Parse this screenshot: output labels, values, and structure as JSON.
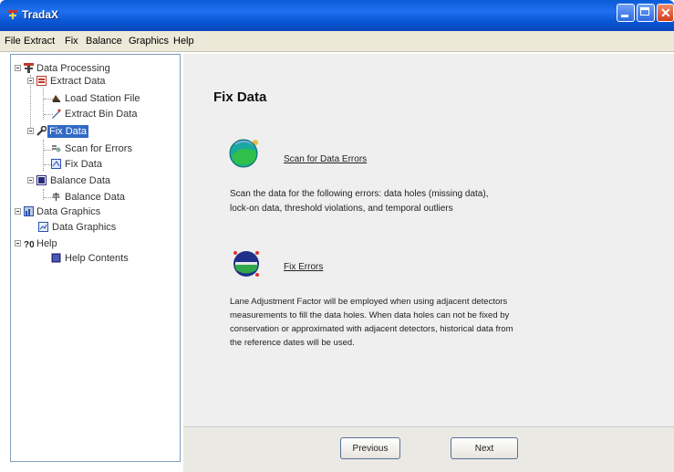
{
  "window": {
    "title": "TradaX"
  },
  "menu": [
    "File",
    "Extract",
    "Fix",
    "Balance",
    "Graphics",
    "Help"
  ],
  "tree": {
    "data_processing": "Data Processing",
    "extract_data": "Extract Data",
    "load_station_file": "Load Station File",
    "extract_bin_data": "Extract Bin Data",
    "fix_data": "Fix Data",
    "scan_for_errors": "Scan for Errors",
    "fix_data_child": "Fix Data",
    "balance_data": "Balance Data",
    "balance_data_child": "Balance Data",
    "data_graphics": "Data Graphics",
    "data_graphics_child": "Data Graphics",
    "help": "Help",
    "help_contents": "Help Contents"
  },
  "content": {
    "title": "Fix Data",
    "scan_link": "Scan for Data Errors",
    "scan_desc_1": "Scan the data for the following errors: data holes (missing data),",
    "scan_desc_2": "lock-on data, threshold violations, and temporal outliers",
    "fix_link": "Fix Errors",
    "fix_desc_1": "Lane Adjustment Factor will be employed when using adjacent detectors",
    "fix_desc_2": "measurements to fill the data holes. When data holes can not be fixed by",
    "fix_desc_3": "conservation or approximated with adjacent detectors, historical data from",
    "fix_desc_4": "the reference dates will be used."
  },
  "footer": {
    "previous": "Previous",
    "next": "Next"
  },
  "colors": {
    "titlebar": "#0a5bd6",
    "selection": "#316ac5",
    "content_bg": "#f0efef"
  }
}
